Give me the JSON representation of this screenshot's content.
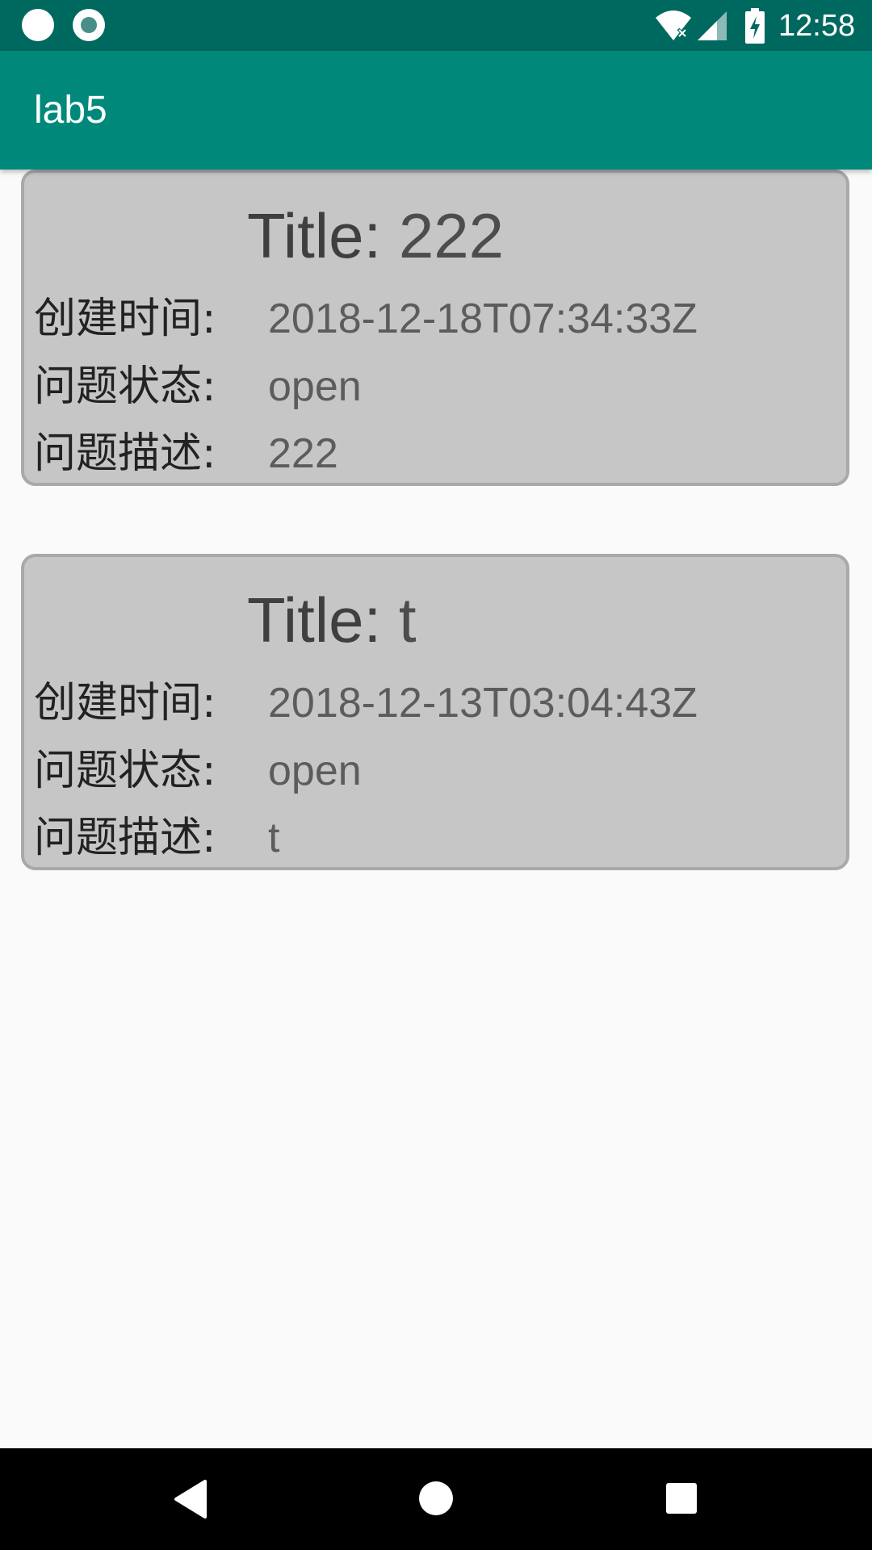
{
  "status_bar": {
    "time": "12:58",
    "icons": [
      "notification-dot-icon",
      "notification-ring-icon",
      "wifi-icon",
      "cell-signal-icon",
      "battery-charging-icon"
    ]
  },
  "app_bar": {
    "title": "lab5"
  },
  "issues": [
    {
      "title_prefix": "Title: ",
      "title": "222",
      "created_label": "创建时间:",
      "created": "2018-12-18T07:34:33Z",
      "state_label": "问题状态:",
      "state": "open",
      "desc_label": "问题描述:",
      "desc": "222"
    },
    {
      "title_prefix": "Title: ",
      "title": "t",
      "created_label": "创建时间:",
      "created": "2018-12-13T03:04:43Z",
      "state_label": "问题状态:",
      "state": "open",
      "desc_label": "问题描述:",
      "desc": "t"
    }
  ],
  "nav_bar": {
    "buttons": [
      "back-icon",
      "home-icon",
      "recents-icon"
    ]
  },
  "colors": {
    "status_bar": "#00695f",
    "app_bar": "#00897b",
    "card": "#c6c6c6",
    "background": "#fafafa"
  }
}
